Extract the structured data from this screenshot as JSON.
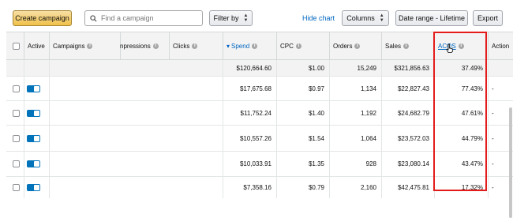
{
  "toolbar": {
    "create_label": "Create campaign",
    "search_placeholder": "Find a campaign",
    "filter_label": "Filter by",
    "hide_chart_label": "Hide chart",
    "columns_label": "Columns",
    "date_range_label": "Date range - Lifetime",
    "export_label": "Export"
  },
  "table": {
    "headers": {
      "active": "Active",
      "campaigns": "Campaigns",
      "impressions": "npressions",
      "clicks": "Clicks",
      "spend": "Spend",
      "cpc": "CPC",
      "orders": "Orders",
      "sales": "Sales",
      "acos": "ACOS",
      "actions": "Action"
    },
    "sort_indicator": "▾",
    "totals": {
      "spend": "$120,664.60",
      "cpc": "$1.00",
      "orders": "15,249",
      "sales": "$321,856.63",
      "acos": "37.49%"
    },
    "rows": [
      {
        "spend": "$17,675.68",
        "cpc": "$0.97",
        "orders": "1,134",
        "sales": "$22,827.43",
        "acos": "77.43%",
        "action": "-"
      },
      {
        "spend": "$11,752.24",
        "cpc": "$1.40",
        "orders": "1,192",
        "sales": "$24,682.79",
        "acos": "47.61%",
        "action": "-"
      },
      {
        "spend": "$10,557.26",
        "cpc": "$1.54",
        "orders": "1,064",
        "sales": "$23,572.03",
        "acos": "44.79%",
        "action": "-"
      },
      {
        "spend": "$10,033.91",
        "cpc": "$1.35",
        "orders": "928",
        "sales": "$23,080.14",
        "acos": "43.47%",
        "action": "-"
      },
      {
        "spend": "$7,358.16",
        "cpc": "$0.79",
        "orders": "2,160",
        "sales": "$42,475.81",
        "acos": "17.32%",
        "action": "-"
      }
    ]
  },
  "icons": {
    "search": "magnifier-icon",
    "info": "info-circle-icon",
    "cursor": "hand-pointer-icon"
  },
  "colors": {
    "create_button": "#f0c14b",
    "link": "#0066c0",
    "toggle_on": "#0073bb",
    "highlight_box": "#e31b1b"
  }
}
